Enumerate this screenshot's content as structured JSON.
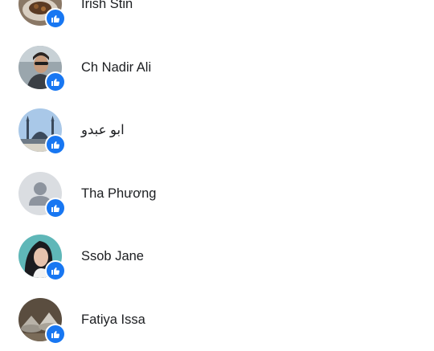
{
  "reactions": {
    "people": [
      {
        "name": "Irish Stin",
        "avatar": "photo-food-icon",
        "reaction": "like-icon"
      },
      {
        "name": "Ch Nadir Ali",
        "avatar": "photo-man-icon",
        "reaction": "like-icon"
      },
      {
        "name": "ابو عبدو",
        "avatar": "photo-mosque-icon",
        "reaction": "like-icon"
      },
      {
        "name": "Tha Phương",
        "avatar": "default-user-icon",
        "reaction": "like-icon"
      },
      {
        "name": "Ssob Jane",
        "avatar": "photo-woman-icon",
        "reaction": "like-icon"
      },
      {
        "name": "Fatiya Issa",
        "avatar": "photo-dishes-icon",
        "reaction": "like-icon"
      }
    ]
  },
  "colors": {
    "like_badge": "#1877f2",
    "name_text": "#1c1e21",
    "default_avatar_bg": "#c9ccd1",
    "default_avatar_fg": "#65676b"
  }
}
